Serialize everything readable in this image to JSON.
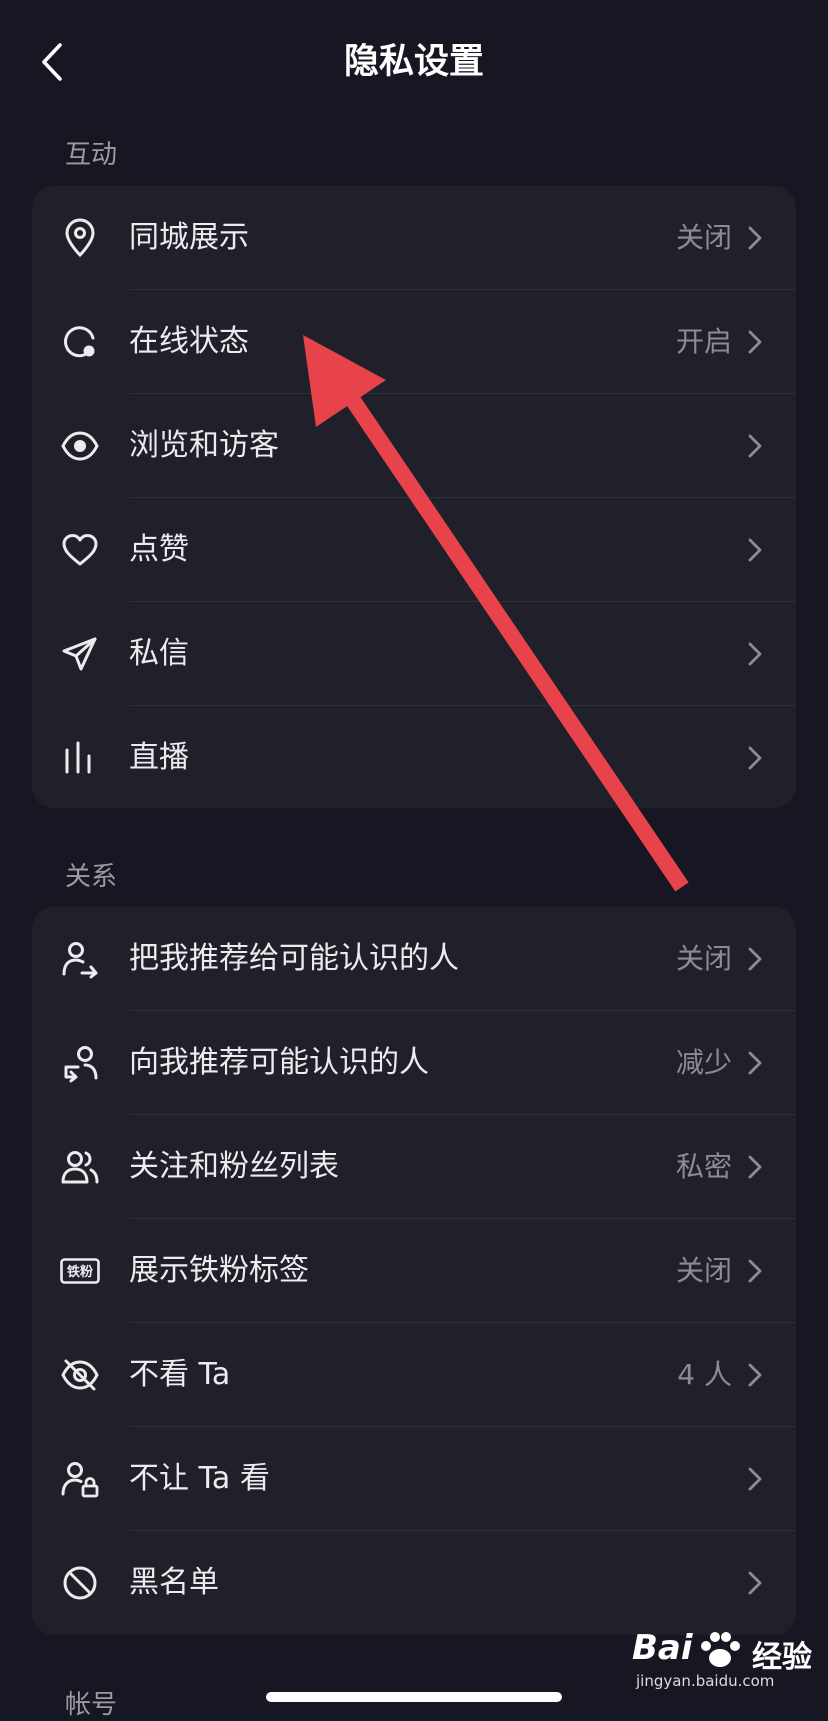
{
  "header": {
    "title": "隐私设置"
  },
  "sections": [
    {
      "label": "互动",
      "items": [
        {
          "icon": "location-pin-icon",
          "label": "同城展示",
          "value": "关闭"
        },
        {
          "icon": "online-status-icon",
          "label": "在线状态",
          "value": "开启"
        },
        {
          "icon": "eye-icon",
          "label": "浏览和访客",
          "value": ""
        },
        {
          "icon": "heart-icon",
          "label": "点赞",
          "value": ""
        },
        {
          "icon": "send-icon",
          "label": "私信",
          "value": ""
        },
        {
          "icon": "live-bars-icon",
          "label": "直播",
          "value": ""
        }
      ]
    },
    {
      "label": "关系",
      "items": [
        {
          "icon": "user-share-icon",
          "label": "把我推荐给可能认识的人",
          "value": "关闭"
        },
        {
          "icon": "user-recommend-icon",
          "label": "向我推荐可能认识的人",
          "value": "减少"
        },
        {
          "icon": "users-icon",
          "label": "关注和粉丝列表",
          "value": "私密"
        },
        {
          "icon": "fan-badge-icon",
          "label": "展示铁粉标签",
          "value": "关闭",
          "badge_text": "铁粉"
        },
        {
          "icon": "eye-off-icon",
          "label": "不看 Ta",
          "value": "4 人"
        },
        {
          "icon": "user-lock-icon",
          "label": "不让 Ta 看",
          "value": ""
        },
        {
          "icon": "block-icon",
          "label": "黑名单",
          "value": ""
        }
      ]
    },
    {
      "label": "帐号"
    }
  ],
  "watermark": {
    "brand": "Bai",
    "brand_cn": "经验",
    "url": "jingyan.baidu.com"
  },
  "colors": {
    "background": "#161722",
    "card": "#1f2029",
    "arrow": "#e8434b"
  }
}
